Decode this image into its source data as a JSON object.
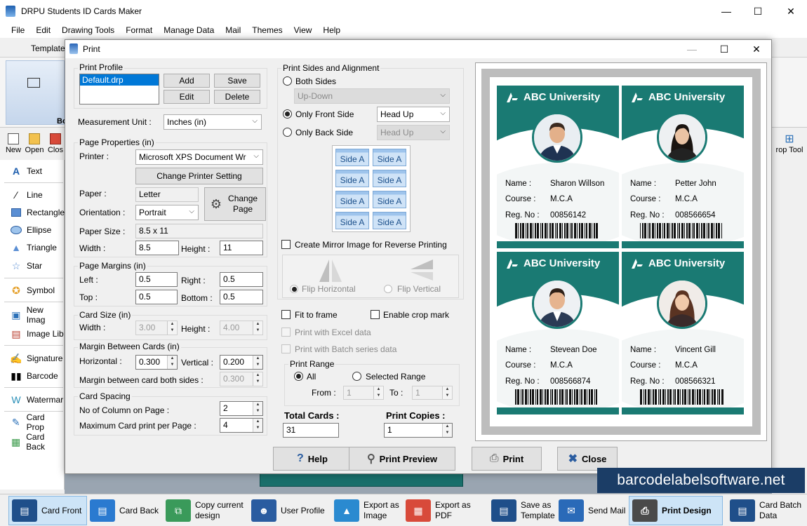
{
  "app": {
    "title": "DRPU Students ID Cards Maker",
    "menu": [
      "File",
      "Edit",
      "Drawing Tools",
      "Format",
      "Manage Data",
      "Mail",
      "Themes",
      "View",
      "Help"
    ],
    "ribbon_tab": "Template",
    "ribbon_group_label": "Bo",
    "toolbar": [
      {
        "label": "New"
      },
      {
        "label": "Open"
      },
      {
        "label": "Clos"
      }
    ],
    "crop_tool": "rop Tool",
    "left_tools": [
      {
        "label": "Text"
      },
      {
        "label": "Line"
      },
      {
        "label": "Rectangle"
      },
      {
        "label": "Ellipse"
      },
      {
        "label": "Triangle"
      },
      {
        "label": "Star"
      },
      {
        "label": "Symbol"
      },
      {
        "label": "New Imag"
      },
      {
        "label": "Image Lib"
      },
      {
        "label": "Signature"
      },
      {
        "label": "Barcode"
      },
      {
        "label": "Watermar"
      },
      {
        "label": "Card Prop"
      },
      {
        "label": "Card Back"
      }
    ],
    "bottom": [
      {
        "label": "Card Front"
      },
      {
        "label": "Card Back"
      },
      {
        "label": "Copy current design"
      },
      {
        "label": "User Profile"
      },
      {
        "label": "Export as Image"
      },
      {
        "label": "Export as PDF"
      },
      {
        "label": "Save as Template"
      },
      {
        "label": "Send Mail"
      },
      {
        "label": "Print Design"
      },
      {
        "label": "Card Batch Data"
      }
    ],
    "watermark": "barcodelabelsoftware.net"
  },
  "dialog": {
    "title": "Print",
    "profile": {
      "group": "Print Profile",
      "item": "Default.drp",
      "add": "Add",
      "save": "Save",
      "edit": "Edit",
      "delete": "Delete"
    },
    "measurement": {
      "label": "Measurement Unit :",
      "value": "Inches (in)"
    },
    "page": {
      "group": "Page Properties (in)",
      "printer_label": "Printer :",
      "printer": "Microsoft XPS Document Wr",
      "change_printer": "Change Printer Setting",
      "paper_label": "Paper :",
      "paper": "Letter",
      "orientation_label": "Orientation :",
      "orientation": "Portrait",
      "change_page": "Change Page",
      "size_label": "Paper Size :",
      "size": "8.5 x 11",
      "width_label": "Width :",
      "width": "8.5",
      "height_label": "Height :",
      "height": "11"
    },
    "margins": {
      "group": "Page Margins (in)",
      "left_label": "Left :",
      "left": "0.5",
      "right_label": "Right :",
      "right": "0.5",
      "top_label": "Top :",
      "top": "0.5",
      "bottom_label": "Bottom :",
      "bottom": "0.5"
    },
    "card_size": {
      "group": "Card Size (in)",
      "width_label": "Width :",
      "width": "3.00",
      "height_label": "Height :",
      "height": "4.00"
    },
    "margin_between": {
      "group": "Margin Between Cards (in)",
      "h_label": "Horizontal :",
      "h": "0.300",
      "v_label": "Vertical :",
      "v": "0.200",
      "both_label": "Margin between card both sides :",
      "both": "0.300"
    },
    "spacing": {
      "group": "Card Spacing",
      "cols_label": "No of Column on Page :",
      "cols": "2",
      "max_label": "Maximum Card print per Page :",
      "max": "4"
    },
    "sides": {
      "group": "Print Sides and Alignment",
      "both": "Both Sides",
      "both_value": "Up-Down",
      "front": "Only Front Side",
      "front_value": "Head Up",
      "back": "Only Back Side",
      "back_value": "Head Up",
      "cells": [
        "Side A",
        "Side A",
        "Side A",
        "Side A",
        "Side A",
        "Side A",
        "Side A",
        "Side A"
      ]
    },
    "mirror": {
      "label": "Create Mirror Image for Reverse Printing",
      "flip_h": "Flip Horizontal",
      "flip_v": "Flip Vertical"
    },
    "options": {
      "fit": "Fit to frame",
      "crop": "Enable crop mark",
      "excel": "Print with Excel data",
      "batch": "Print with Batch series data"
    },
    "range": {
      "group": "Print Range",
      "all": "All",
      "selected": "Selected Range",
      "from_label": "From :",
      "from": "1",
      "to_label": "To :",
      "to": "1"
    },
    "totals": {
      "total_label": "Total Cards :",
      "total": "31",
      "copies_label": "Print Copies :",
      "copies": "1"
    },
    "buttons": {
      "help": "Help",
      "preview": "Print Preview",
      "print": "Print",
      "close": "Close"
    }
  },
  "cards": [
    {
      "university": "ABC University",
      "name_label": "Name :",
      "name": "Sharon Willson",
      "course_label": "Course :",
      "course": "M.C.A",
      "reg_label": "Reg. No :",
      "reg": "00856142"
    },
    {
      "university": "ABC University",
      "name_label": "Name :",
      "name": "Petter John",
      "course_label": "Course :",
      "course": "M.C.A",
      "reg_label": "Reg. No :",
      "reg": "008566654"
    },
    {
      "university": "ABC University",
      "name_label": "Name :",
      "name": "Stevean Doe",
      "course_label": "Course :",
      "course": "M.C.A",
      "reg_label": "Reg. No :",
      "reg": "008566874"
    },
    {
      "university": "ABC University",
      "name_label": "Name :",
      "name": "Vincent Gill",
      "course_label": "Course :",
      "course": "M.C.A",
      "reg_label": "Reg. No :",
      "reg": "008566321"
    }
  ]
}
